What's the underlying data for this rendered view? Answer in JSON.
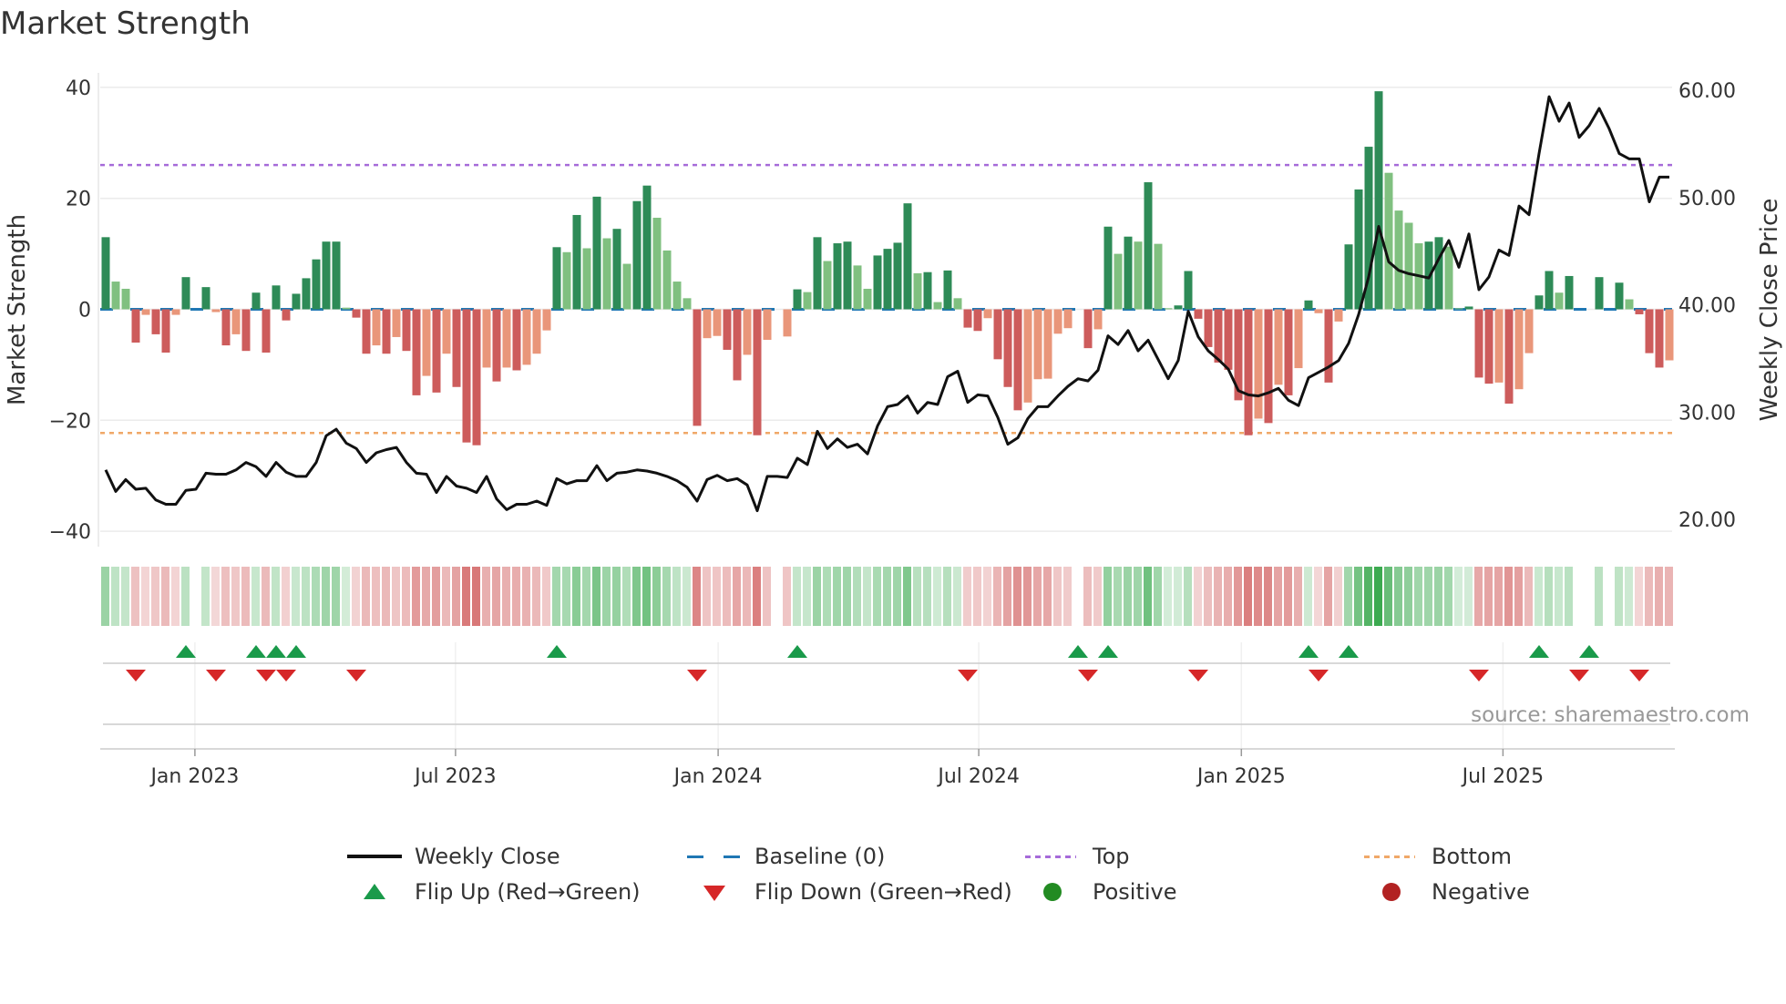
{
  "title": "Market Strength",
  "source": "source: sharemaestro.com",
  "colors": {
    "strong_green": "#2e8b57",
    "light_green": "#80c080",
    "strong_red": "#cd5c5c",
    "light_red": "#e9967a",
    "baseline": "#1f77b4",
    "top": "#a66bd9",
    "bottom": "#f0a868",
    "price": "#111111",
    "flip_up": "#1a9a4a",
    "flip_down": "#d62728",
    "positive": "#228b22",
    "negative": "#b22222"
  },
  "legend": [
    {
      "label": "Weekly Close",
      "icon": "solid-line"
    },
    {
      "label": "Baseline (0)",
      "icon": "dashed-line"
    },
    {
      "label": "Top",
      "icon": "dotted-line"
    },
    {
      "label": "Bottom",
      "icon": "dotted-line"
    },
    {
      "label": "Flip Up (Red→Green)",
      "icon": "triangle-up"
    },
    {
      "label": "Flip Down (Green→Red)",
      "icon": "triangle-down"
    },
    {
      "label": "Positive",
      "icon": "circle"
    },
    {
      "label": "Negative",
      "icon": "circle"
    }
  ],
  "chart_data": {
    "type": "bar",
    "title": "Market Strength",
    "ylabel": "Market Strength",
    "y2label": "Weekly Close Price",
    "ylim": [
      -40,
      40
    ],
    "y2lim": [
      20,
      60
    ],
    "yticks": [
      "40",
      "20",
      "0",
      "−20",
      "−40"
    ],
    "yticks_values": [
      40,
      20,
      0,
      -20,
      -40
    ],
    "y2ticks": [
      "60.00",
      "50.00",
      "40.00",
      "30.00",
      "20.00"
    ],
    "y2ticks_values": [
      60,
      50,
      40,
      30,
      20
    ],
    "xticks": [
      "Jan 2023",
      "Jul 2023",
      "Jan 2024",
      "Jul 2024",
      "Jan 2025",
      "Jul 2025"
    ],
    "xticks_week_index": [
      8.9,
      34.9,
      61.1,
      87.1,
      113.3,
      139.4
    ],
    "x_start": "2022-10-30",
    "x_step": "weekly",
    "top_level": 26,
    "bottom_level": -22.3,
    "baseline": 0,
    "strength": [
      13,
      5,
      3.7,
      -6,
      -1,
      -4.5,
      -7.8,
      -1,
      5.8,
      0,
      4,
      -0.5,
      -6.5,
      -4.5,
      -7.5,
      3,
      -7.8,
      4.3,
      -2,
      2.8,
      5.6,
      9,
      12.2,
      12.2,
      0.3,
      -1.5,
      -8,
      -6.5,
      -8,
      -5,
      -7.5,
      -15.5,
      -12,
      -15,
      -8,
      -14,
      -24,
      -24.5,
      -10.5,
      -13,
      -10.5,
      -11,
      -10,
      -8,
      -3.8,
      11.2,
      10.3,
      17,
      11,
      20.3,
      12.8,
      14.5,
      8.2,
      19.5,
      22.3,
      16.5,
      10.6,
      5,
      2,
      -21,
      -5.2,
      -4.8,
      -7.3,
      -12.8,
      -8.2,
      -22.7,
      -5.5,
      0,
      -4.9,
      3.6,
      3.1,
      13,
      8.7,
      11.9,
      12.2,
      7.9,
      3.7,
      9.7,
      10.9,
      12,
      19.1,
      6.5,
      6.7,
      1.3,
      7,
      2,
      -3.3,
      -3.9,
      -1.6,
      -9,
      -14,
      -18.2,
      -16.8,
      -12.6,
      -12.5,
      -4.4,
      -3.4,
      0,
      -7,
      -3.6,
      14.9,
      10,
      13.1,
      12.2,
      22.9,
      11.8,
      0.2,
      0.7,
      6.9,
      -1.7,
      -6.8,
      -9.6,
      -10.9,
      -16.4,
      -22.7,
      -19.7,
      -20.5,
      -13.6,
      -15.5,
      -10.6,
      1.6,
      -0.7,
      -13.2,
      -2.2,
      11.7,
      21.6,
      29.3,
      39.3,
      24.6,
      17.8,
      15.6,
      11.9,
      12.2,
      13,
      11.3,
      0.2,
      0.5,
      -12.3,
      -13.4,
      -13.2,
      -17,
      -14.4,
      -7.9,
      2.5,
      6.9,
      3,
      6,
      0,
      0,
      5.8,
      0,
      4.8,
      1.8,
      -0.9,
      -7.9,
      -10.5,
      -9.2
    ],
    "shade": "GggRrRRrG0GrRrRGRGRGGGGGgRRrRrRRrRrRRRrRrRrrrGgGgGgGgGGggggRrrRRrRr0rGgGgGGggGGGGgGgGgRRrRRRrrrrr0RrGgGgGggGGRRRRRRrRrRrGrRrGGGGggggGGggGRRrRrrGGgG00G0GgRRRr",
    "weekly_close": [
      24.6,
      22.6,
      23.7,
      22.8,
      22.9,
      21.8,
      21.4,
      21.4,
      22.7,
      22.8,
      24.3,
      24.2,
      24.2,
      24.6,
      25.3,
      24.9,
      24.0,
      25.3,
      24.4,
      24.0,
      24.0,
      25.3,
      27.8,
      28.4,
      27.1,
      26.6,
      25.3,
      26.2,
      26.5,
      26.7,
      25.3,
      24.3,
      24.2,
      22.5,
      24.0,
      23.1,
      22.9,
      22.5,
      24.0,
      21.9,
      20.9,
      21.4,
      21.4,
      21.7,
      21.3,
      23.8,
      23.3,
      23.6,
      23.6,
      25.0,
      23.6,
      24.3,
      24.4,
      24.6,
      24.5,
      24.3,
      24.0,
      23.6,
      23.0,
      21.7,
      23.7,
      24.1,
      23.6,
      23.8,
      23.2,
      20.8,
      24.0,
      24.0,
      23.9,
      25.7,
      25.1,
      28.2,
      26.6,
      27.5,
      26.7,
      27.0,
      26.1,
      28.7,
      30.5,
      30.7,
      31.5,
      29.9,
      30.9,
      30.7,
      33.3,
      33.8,
      30.9,
      31.6,
      31.5,
      29.5,
      27.0,
      27.6,
      29.4,
      30.5,
      30.5,
      31.5,
      32.4,
      33.1,
      32.9,
      33.9,
      37.1,
      36.3,
      37.6,
      35.7,
      36.7,
      34.9,
      33.1,
      34.8,
      39.4,
      37.0,
      35.7,
      34.9,
      34.0,
      32.0,
      31.6,
      31.5,
      31.8,
      32.2,
      31.1,
      30.6,
      33.2,
      33.7,
      34.2,
      34.8,
      36.4,
      39.1,
      42.6,
      47.3,
      44.0,
      43.2,
      42.9,
      42.7,
      42.5,
      44.3,
      46.0,
      43.5,
      46.6,
      41.4,
      42.6,
      45.1,
      44.6,
      49.2,
      48.4,
      54.1,
      59.4,
      57.1,
      58.8,
      55.6,
      56.7,
      58.3,
      56.4,
      54.1,
      53.6,
      53.6,
      49.6,
      51.9,
      51.9
    ],
    "flip_up_week_index": [
      8,
      15,
      17,
      19,
      45,
      69,
      97,
      100,
      120,
      124,
      143,
      148
    ],
    "flip_down_week_index": [
      3,
      11,
      16,
      18,
      25,
      59,
      86,
      98,
      109,
      121,
      137,
      147,
      153
    ],
    "legend_placement": "bottom-center",
    "grid": true
  }
}
